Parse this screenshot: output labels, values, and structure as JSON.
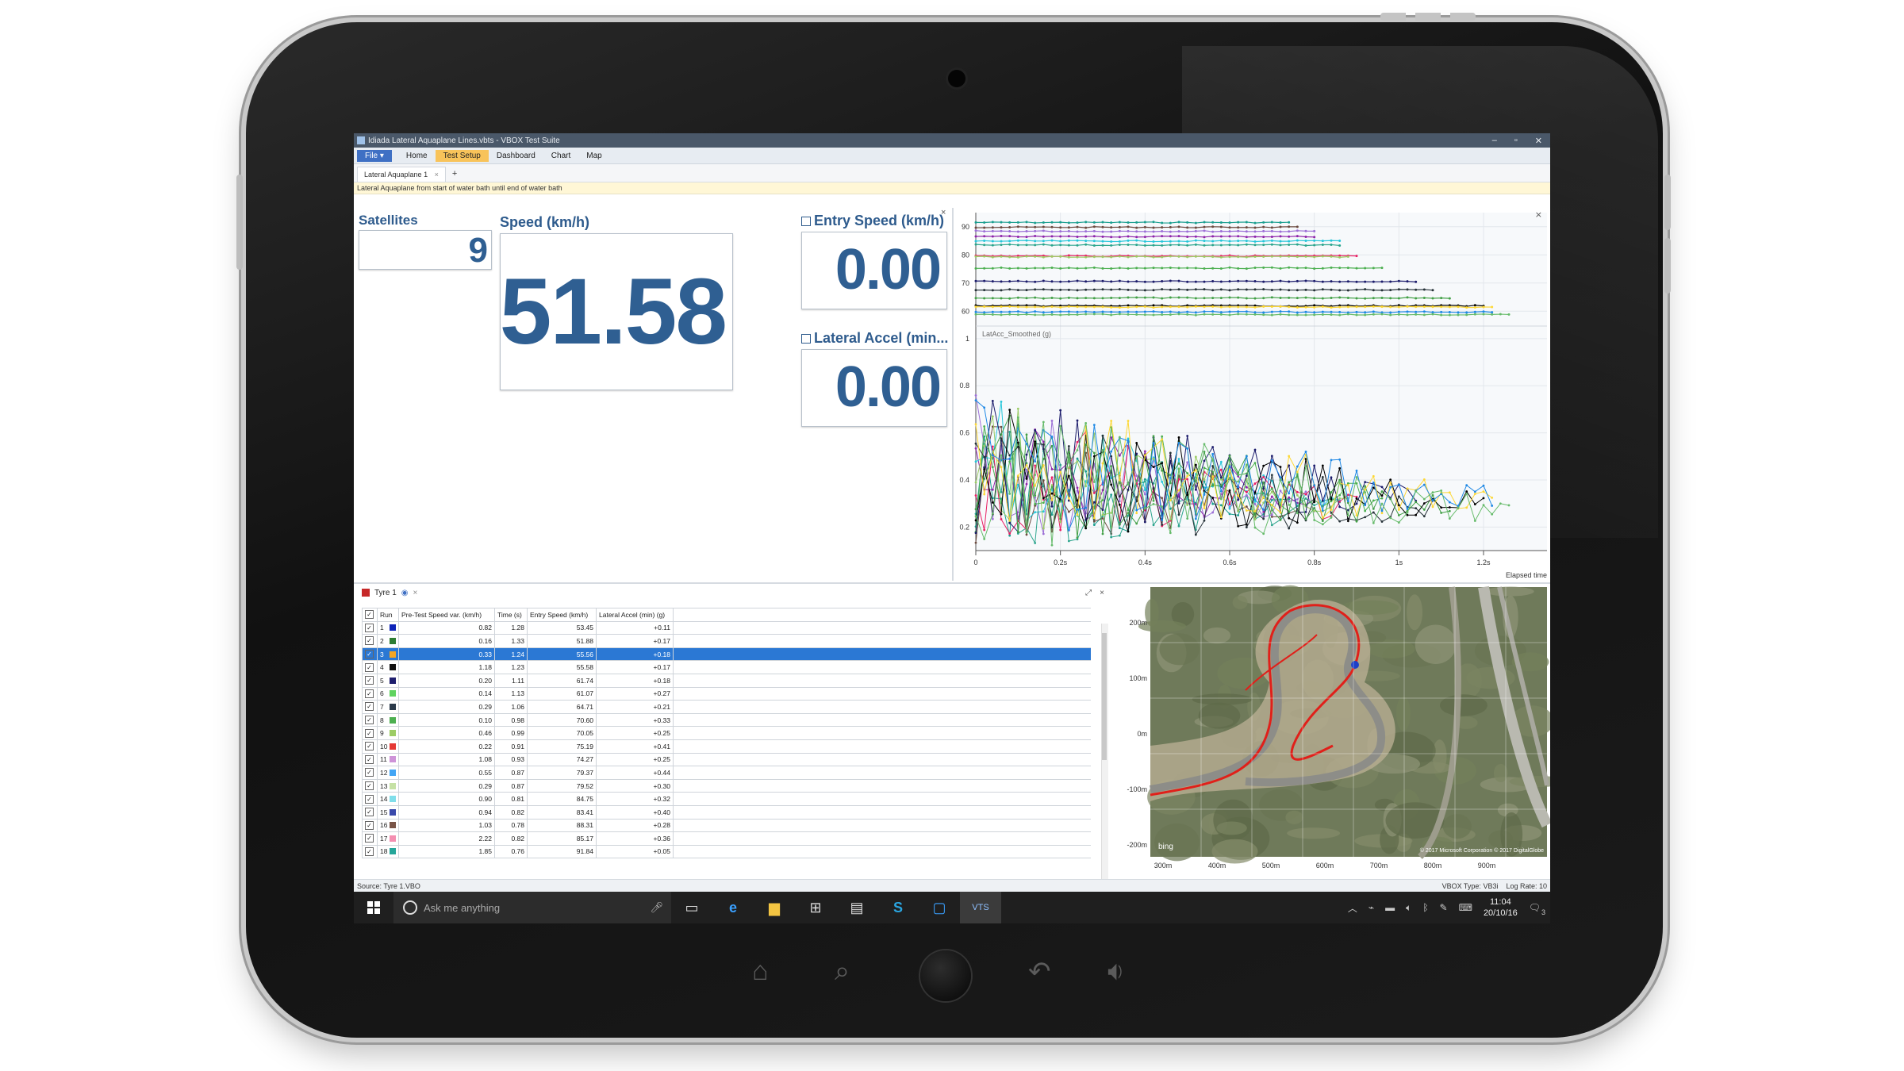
{
  "window": {
    "title": "Idiada Lateral Aquaplane Lines.vbts - VBOX Test Suite",
    "controls": [
      "–",
      "▫",
      "✕"
    ]
  },
  "menu": {
    "file": "File ▾",
    "items": [
      "Home",
      "Test Setup",
      "Dashboard",
      "Chart",
      "Map"
    ]
  },
  "tabs": {
    "active": "Lateral Aquaplane 1",
    "close": "×",
    "add": "+"
  },
  "description": "Lateral Aquaplane from start of water bath until end of water bath",
  "dashboard": {
    "satellites": {
      "label": "Satellites",
      "value": "9"
    },
    "speed": {
      "label": "Speed (km/h)",
      "value": "51.58"
    },
    "entry_speed": {
      "label": "Entry Speed (km/h)",
      "value": "0.00"
    },
    "lateral_accel": {
      "label": "Lateral Accel (min...",
      "value": "0.00"
    }
  },
  "chart_data": {
    "type": "line",
    "top_panel": {
      "yticks": [
        "90",
        "80",
        "70",
        "60"
      ],
      "ylim": [
        55,
        95
      ]
    },
    "bottom_panel": {
      "title": "LatAcc_Smoothed (g)",
      "yticks": [
        "1",
        "0.8",
        "0.6",
        "0.4",
        "0.2"
      ],
      "ylim": [
        0.1,
        1.05
      ]
    },
    "xticks": [
      "0",
      "0.2s",
      "0.4s",
      "0.6s",
      "0.8s",
      "1s",
      "1.2s"
    ],
    "xlim": [
      0,
      1.35
    ],
    "xlabel": "Elapsed time",
    "series": [
      {
        "color": "#1a9e8f",
        "speed": 91.5,
        "end": 0.76
      },
      {
        "color": "#6d4c41",
        "speed": 89.8,
        "end": 0.78
      },
      {
        "color": "#9c6fd6",
        "speed": 88.4,
        "end": 0.82
      },
      {
        "color": "#8e24aa",
        "speed": 86.5,
        "end": 0.81
      },
      {
        "color": "#26c6da",
        "speed": 84.9,
        "end": 0.87
      },
      {
        "color": "#2ca58d",
        "speed": 83.5,
        "end": 0.87
      },
      {
        "color": "#e91e63",
        "speed": 79.6,
        "end": 0.91
      },
      {
        "color": "#9ccc65",
        "speed": 79.3,
        "end": 0.9
      },
      {
        "color": "#4caf50",
        "speed": 75.3,
        "end": 0.98
      },
      {
        "color": "#1b1b6b",
        "speed": 70.6,
        "end": 1.06
      },
      {
        "color": "#263238",
        "speed": 67.6,
        "end": 1.1
      },
      {
        "color": "#43a047",
        "speed": 64.7,
        "end": 1.13
      },
      {
        "color": "#000000",
        "speed": 61.9,
        "end": 1.22
      },
      {
        "color": "#fdd835",
        "speed": 61.5,
        "end": 1.23
      },
      {
        "color": "#1e88e5",
        "speed": 59.7,
        "end": 1.24
      },
      {
        "color": "#66bb6a",
        "speed": 58.8,
        "end": 1.28
      }
    ]
  },
  "table": {
    "panel_title": "Tyre 1",
    "columns": [
      "Run",
      "Pre-Test Speed var. (km/h)",
      "Time (s)",
      "Entry Speed (km/h)",
      "Lateral Accel (min) (g)"
    ],
    "rows": [
      {
        "run": "1",
        "color": "#0d23b8",
        "pre": "0.82",
        "time": "1.28",
        "entry": "53.45",
        "lat": "+0.11"
      },
      {
        "run": "2",
        "color": "#2e7d32",
        "pre": "0.16",
        "time": "1.33",
        "entry": "51.88",
        "lat": "+0.17"
      },
      {
        "run": "3",
        "color": "#f5a623",
        "pre": "0.33",
        "time": "1.24",
        "entry": "55.56",
        "lat": "+0.18"
      },
      {
        "run": "4",
        "color": "#111111",
        "pre": "1.18",
        "time": "1.23",
        "entry": "55.58",
        "lat": "+0.17"
      },
      {
        "run": "5",
        "color": "#1e1e6e",
        "pre": "0.20",
        "time": "1.11",
        "entry": "61.74",
        "lat": "+0.18"
      },
      {
        "run": "6",
        "color": "#5fd35f",
        "pre": "0.14",
        "time": "1.13",
        "entry": "61.07",
        "lat": "+0.27"
      },
      {
        "run": "7",
        "color": "#2b3a4a",
        "pre": "0.29",
        "time": "1.06",
        "entry": "64.71",
        "lat": "+0.21"
      },
      {
        "run": "8",
        "color": "#4caf50",
        "pre": "0.10",
        "time": "0.98",
        "entry": "70.60",
        "lat": "+0.33"
      },
      {
        "run": "9",
        "color": "#9ccc65",
        "pre": "0.46",
        "time": "0.99",
        "entry": "70.05",
        "lat": "+0.25"
      },
      {
        "run": "10",
        "color": "#e53935",
        "pre": "0.22",
        "time": "0.91",
        "entry": "75.19",
        "lat": "+0.41"
      },
      {
        "run": "11",
        "color": "#ce93d8",
        "pre": "1.08",
        "time": "0.93",
        "entry": "74.27",
        "lat": "+0.25"
      },
      {
        "run": "12",
        "color": "#42a5f5",
        "pre": "0.55",
        "time": "0.87",
        "entry": "79.37",
        "lat": "+0.44"
      },
      {
        "run": "13",
        "color": "#c5e1a5",
        "pre": "0.29",
        "time": "0.87",
        "entry": "79.52",
        "lat": "+0.30"
      },
      {
        "run": "14",
        "color": "#80deea",
        "pre": "0.90",
        "time": "0.81",
        "entry": "84.75",
        "lat": "+0.32"
      },
      {
        "run": "15",
        "color": "#3949ab",
        "pre": "0.94",
        "time": "0.82",
        "entry": "83.41",
        "lat": "+0.40"
      },
      {
        "run": "16",
        "color": "#795548",
        "pre": "1.03",
        "time": "0.78",
        "entry": "88.31",
        "lat": "+0.28"
      },
      {
        "run": "17",
        "color": "#f48fb1",
        "pre": "2.22",
        "time": "0.82",
        "entry": "85.17",
        "lat": "+0.36"
      },
      {
        "run": "18",
        "color": "#26a69a",
        "pre": "1.85",
        "time": "0.76",
        "entry": "91.84",
        "lat": "+0.05"
      }
    ],
    "selected_run": "3"
  },
  "map": {
    "yticks": [
      "200m",
      "100m",
      "0m",
      "-100m",
      "-200m"
    ],
    "xticks": [
      "300m",
      "400m",
      "500m",
      "600m",
      "700m",
      "800m",
      "900m"
    ],
    "attribution": "© 2017 Microsoft Corporation © 2017 DigitalGlobe",
    "provider": "bing"
  },
  "status": {
    "source": "Source: Tyre 1.VBO",
    "vbox_type": "VBOX Type: VB3i",
    "log_rate": "Log Rate: 10"
  },
  "taskbar": {
    "search_placeholder": "Ask me anything",
    "time": "11:04",
    "date": "20/10/16",
    "notifications": "3"
  },
  "colors": {
    "accent": "#2e5b8d",
    "selection": "#2b78d4",
    "titlebar": "#4a5869"
  }
}
